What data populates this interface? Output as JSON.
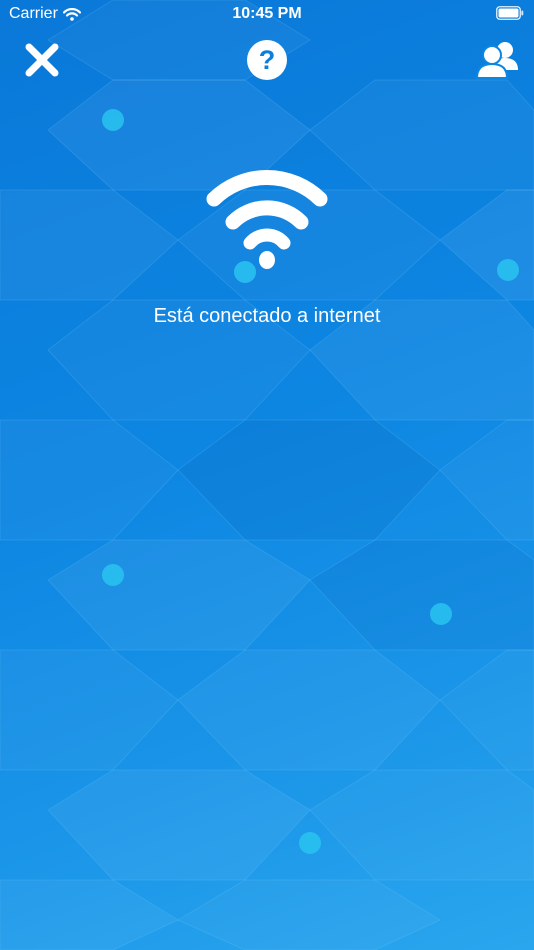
{
  "status_bar": {
    "carrier": "Carrier",
    "time": "10:45 PM",
    "wifi_icon": "wifi-icon",
    "battery_icon": "battery-icon"
  },
  "nav": {
    "close_icon": "close-icon",
    "help_icon": "help-icon",
    "help_glyph": "?",
    "users_icon": "users-icon"
  },
  "main": {
    "hero_icon": "wifi-icon",
    "status_text": "Está conectado a internet"
  },
  "colors": {
    "background_start": "#0a78d8",
    "background_end": "#2aa6ee",
    "node_dot": "#29c3f0",
    "foreground": "#ffffff"
  }
}
